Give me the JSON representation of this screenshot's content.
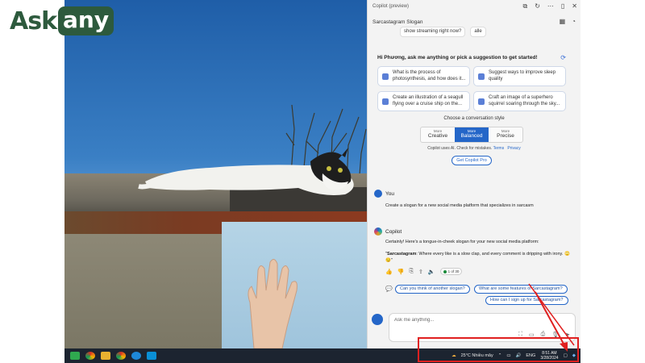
{
  "logo": {
    "part1": "Ask",
    "part2": "any"
  },
  "copilot": {
    "window_title": "Copilot (preview)",
    "conversation_title": "Sarcastagram Slogan",
    "top_chips": [
      "show streaming right now?",
      "alle"
    ],
    "greeting": "Hi Phương, ask me anything or pick a suggestion to get started!",
    "suggestions": [
      "What is the process of photosynthesis, and how does it...",
      "Suggest ways to improve sleep quality",
      "Create an illustration of a seagull flying over a cruise ship on the...",
      "Craft an image of a superhero squirrel soaring through the sky..."
    ],
    "conversation_style_label": "Choose a conversation style",
    "styles": [
      {
        "small": "More",
        "large": "Creative"
      },
      {
        "small": "More",
        "large": "Balanced"
      },
      {
        "small": "More",
        "large": "Precise"
      }
    ],
    "disclaimer": "Copilot uses AI. Check for mistakes.",
    "terms": "Terms",
    "privacy": "Privacy",
    "pro_button": "Get Copilot Pro",
    "user_name": "You",
    "user_message": "Create a slogan for a new social media platform that specializes in sarcasm",
    "bot_name": "Copilot",
    "bot_intro": "Certainly! Here's a tongue-in-cheek slogan for your new social media platform:",
    "bot_slogan_bold": "Sarcastagram",
    "bot_slogan_rest": ": Where every like is a slow clap, and every comment is dripping with irony. 🙄😏",
    "page_indicator": "1 of 30",
    "followups": [
      "Can you think of another slogan?",
      "What are some features of Sarcastagram?",
      "How can I sign up for Sarcastagram?"
    ],
    "input_placeholder": "Ask me anything..."
  },
  "taskbar": {
    "weather": "25°C  Nhiều mây",
    "lang": "ENG",
    "time": "8:51 AM",
    "date": "3/28/2024"
  },
  "colors": {
    "accent": "#2466c8",
    "annotation": "#e02020",
    "logo": "#2d5a3d"
  }
}
